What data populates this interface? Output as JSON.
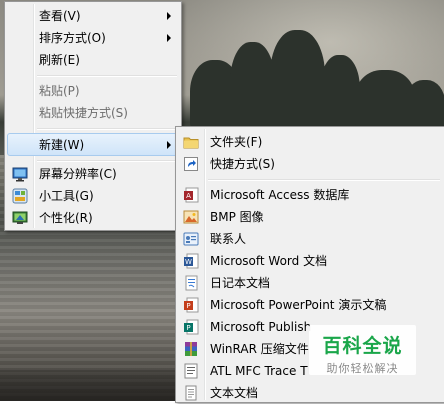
{
  "context_menu": {
    "items": [
      {
        "label": "查看(V)",
        "has_submenu": true,
        "disabled": false
      },
      {
        "label": "排序方式(O)",
        "has_submenu": true,
        "disabled": false
      },
      {
        "label": "刷新(E)",
        "has_submenu": false,
        "disabled": false
      },
      {
        "label": "粘贴(P)",
        "has_submenu": false,
        "disabled": true
      },
      {
        "label": "粘贴快捷方式(S)",
        "has_submenu": false,
        "disabled": true
      },
      {
        "label": "新建(W)",
        "has_submenu": true,
        "disabled": false,
        "highlighted": true
      },
      {
        "label": "屏幕分辨率(C)",
        "icon": "display-icon",
        "disabled": false
      },
      {
        "label": "小工具(G)",
        "icon": "gadgets-icon",
        "disabled": false
      },
      {
        "label": "个性化(R)",
        "icon": "personalize-icon",
        "disabled": false
      }
    ]
  },
  "new_submenu": {
    "items": [
      {
        "label": "文件夹(F)",
        "icon": "folder-icon"
      },
      {
        "label": "快捷方式(S)",
        "icon": "shortcut-icon"
      },
      {
        "label": "Microsoft Access 数据库",
        "icon": "access-icon"
      },
      {
        "label": "BMP 图像",
        "icon": "bmp-image-icon"
      },
      {
        "label": "联系人",
        "icon": "contact-icon"
      },
      {
        "label": "Microsoft Word 文档",
        "icon": "word-icon"
      },
      {
        "label": "日记本文档",
        "icon": "journal-icon"
      },
      {
        "label": "Microsoft PowerPoint 演示文稿",
        "icon": "powerpoint-icon"
      },
      {
        "label": "Microsoft Publish",
        "icon": "publisher-icon"
      },
      {
        "label": "WinRAR 压缩文件",
        "icon": "winrar-icon"
      },
      {
        "label": "ATL MFC Trace T",
        "icon": "atl-trace-icon"
      },
      {
        "label": "文本文档",
        "icon": "text-document-icon"
      }
    ]
  },
  "watermark": {
    "title": "百科全说",
    "subtitle": "助你轻松解决"
  },
  "colors": {
    "menu_bg": "#f0f0f0",
    "hover_bg": "#cfe4f9",
    "hover_border": "#a8cbee",
    "watermark_green": "#1aa64a"
  }
}
